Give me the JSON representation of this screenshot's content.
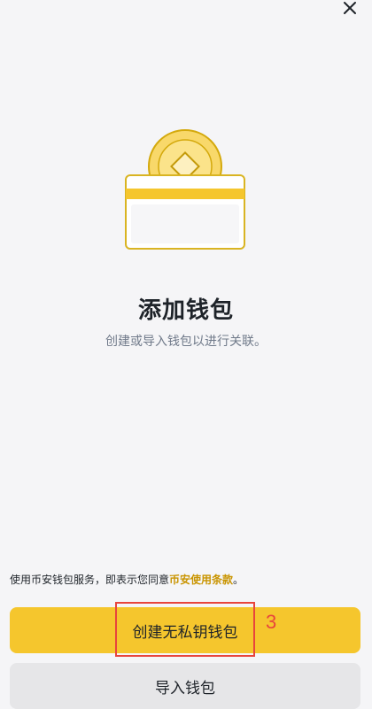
{
  "page": {
    "title": "添加钱包",
    "subtitle": "创建或导入钱包以进行关联。"
  },
  "terms": {
    "prefix": "使用币安钱包服务，即表示您同意",
    "link_label": "币安使用条款",
    "suffix": "。"
  },
  "actions": {
    "create_label": "创建无私钥钱包",
    "import_label": "导入钱包"
  },
  "annotation": {
    "step_number": "3"
  },
  "icons": {
    "close": "close-icon",
    "illustration": "wallet-coin-illustration"
  },
  "colors": {
    "primary": "#f5c62d",
    "link": "#c99400",
    "annotation": "#e8453c",
    "background": "#f5f5f7"
  }
}
